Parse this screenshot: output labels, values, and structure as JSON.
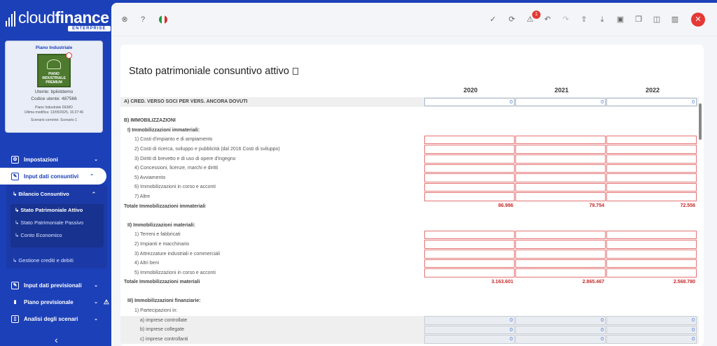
{
  "sidebar": {
    "logo_light": "cloud",
    "logo_bold": "finance",
    "logo_sub": "ENTERPRISE",
    "card": {
      "title": "Piano Industriale",
      "badge_text": "PIANO INDUSTRIALE PREMIUM",
      "user_line": "Utente: bpilotdemo",
      "code_line": "Codice utente: 487566",
      "demo_line": "Piano Industriale DEMO",
      "modified_line": "Ultima modifica: 13/05/2025, 16:27:46",
      "scenario_line": "Scenario corrente: Scenario 1"
    },
    "menu": {
      "impostazioni": "Impostazioni",
      "input_consuntivi": "Input dati consuntivi",
      "bilancio": "Bilancio Consuntivo",
      "sp_attivo": "Stato Patrimoniale Attivo",
      "sp_passivo": "Stato Patrimoniale Passivo",
      "conto_econ": "Conto Economico",
      "gestione": "Gestione crediti e debiti",
      "input_prev": "Input dati previsionali",
      "piano_prev": "Piano previsionale",
      "analisi": "Analisi degli scenari"
    }
  },
  "topbar": {
    "notification_count": "1",
    "icons": [
      "support-icon",
      "help-icon",
      "italy-flag-icon",
      "check-icon",
      "refresh-icon",
      "warning-icon",
      "undo-icon",
      "redo-icon",
      "upload-icon",
      "download-icon",
      "save-icon",
      "copy-icon",
      "split-icon",
      "layout-icon",
      "close-icon"
    ]
  },
  "page": {
    "title": "Stato patrimoniale consuntivo attivo",
    "years": [
      "2020",
      "2021",
      "2022"
    ]
  },
  "rows": [
    {
      "label": "A) CRED. VERSO SOCI PER VERS. ANCORA DOVUTI",
      "bold": true,
      "grey": true,
      "type": "in",
      "values": [
        "0",
        "0",
        "0"
      ]
    },
    {
      "label": "",
      "type": "none"
    },
    {
      "label": "B) IMMOBILIZZAZIONI",
      "bold": true,
      "type": "none"
    },
    {
      "label": "I) Immobilizzazioni immateriali:",
      "bold": true,
      "indent": 1,
      "type": "none"
    },
    {
      "label": "1) Costi d'impianto e di ampiamento",
      "indent": 2,
      "type": "err"
    },
    {
      "label": "2) Costi di ricerca, sviluppo e pubblicità (dal 2016 Costi di sviluppo)",
      "indent": 2,
      "type": "err"
    },
    {
      "label": "3) Diritti di brevetto e di uso di opere d'ingegno",
      "indent": 2,
      "type": "err"
    },
    {
      "label": "4) Concessioni, licenze, marchi e diritti",
      "indent": 2,
      "type": "err"
    },
    {
      "label": "5) Avviamento",
      "indent": 2,
      "type": "err"
    },
    {
      "label": "6) Immobilizzazioni in corso e acconti",
      "indent": 2,
      "type": "err"
    },
    {
      "label": "7) Altre",
      "indent": 2,
      "type": "err"
    },
    {
      "label": "Totale Immobilizzazioni immateriali",
      "bold": true,
      "type": "tot",
      "values": [
        "86.986",
        "79.754",
        "72.556"
      ]
    },
    {
      "label": "",
      "type": "none"
    },
    {
      "label": "II) Immobilizzazioni materiali:",
      "bold": true,
      "indent": 1,
      "type": "none"
    },
    {
      "label": "1) Terreni e fabbricati",
      "indent": 2,
      "type": "err"
    },
    {
      "label": "2) Impianti e macchinario",
      "indent": 2,
      "type": "err"
    },
    {
      "label": "3) Attrezzature industriali e commerciali",
      "indent": 2,
      "type": "err"
    },
    {
      "label": "4) Altri beni",
      "indent": 2,
      "type": "err"
    },
    {
      "label": "5) Immobilizzazioni in corso e acconti",
      "indent": 2,
      "type": "err"
    },
    {
      "label": "Totale Immobilizzazioni materiali",
      "bold": true,
      "type": "tot",
      "values": [
        "3.163.601",
        "2.865.467",
        "2.568.780"
      ]
    },
    {
      "label": "",
      "type": "none"
    },
    {
      "label": "III) Immobilizzazioni finanziarie:",
      "bold": true,
      "indent": 1,
      "type": "none"
    },
    {
      "label": "1) Partecipazioni in:",
      "indent": 2,
      "type": "none"
    },
    {
      "label": "a) imprese controllate",
      "indent": 3,
      "grey": true,
      "type": "ingr",
      "values": [
        "0",
        "0",
        "0"
      ]
    },
    {
      "label": "b) imprese collegate",
      "indent": 3,
      "grey": true,
      "type": "ingr",
      "values": [
        "0",
        "0",
        "0"
      ]
    },
    {
      "label": "c) imprese controllanti",
      "indent": 3,
      "grey": true,
      "type": "ingr",
      "values": [
        "0",
        "0",
        "0"
      ]
    }
  ]
}
